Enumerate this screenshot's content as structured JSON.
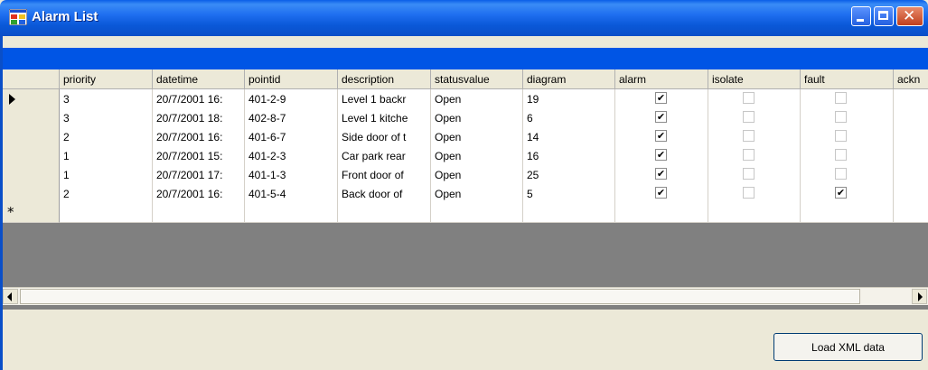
{
  "window": {
    "title": "Alarm List"
  },
  "grid": {
    "columns": [
      "priority",
      "datetime",
      "pointid",
      "description",
      "statusvalue",
      "diagram",
      "alarm",
      "isolate",
      "fault",
      "ackn"
    ],
    "rows": [
      {
        "priority": "3",
        "datetime": "20/7/2001 16:",
        "pointid": "401-2-9",
        "description": "Level 1 backr",
        "statusvalue": "Open",
        "diagram": "19",
        "alarm": true,
        "isolate": false,
        "fault": false,
        "current": true
      },
      {
        "priority": "3",
        "datetime": "20/7/2001 18:",
        "pointid": "402-8-7",
        "description": "Level 1 kitche",
        "statusvalue": "Open",
        "diagram": "6",
        "alarm": true,
        "isolate": false,
        "fault": false,
        "current": false
      },
      {
        "priority": "2",
        "datetime": "20/7/2001 16:",
        "pointid": "401-6-7",
        "description": "Side door of t",
        "statusvalue": "Open",
        "diagram": "14",
        "alarm": true,
        "isolate": false,
        "fault": false,
        "current": false
      },
      {
        "priority": "1",
        "datetime": "20/7/2001 15:",
        "pointid": "401-2-3",
        "description": "Car park rear",
        "statusvalue": "Open",
        "diagram": "16",
        "alarm": true,
        "isolate": false,
        "fault": false,
        "current": false
      },
      {
        "priority": "1",
        "datetime": "20/7/2001 17:",
        "pointid": "401-1-3",
        "description": "Front door of",
        "statusvalue": "Open",
        "diagram": "25",
        "alarm": true,
        "isolate": false,
        "fault": false,
        "current": false
      },
      {
        "priority": "2",
        "datetime": "20/7/2001 16:",
        "pointid": "401-5-4",
        "description": "Back door of",
        "statusvalue": "Open",
        "diagram": "5",
        "alarm": true,
        "isolate": false,
        "fault": true,
        "current": false
      }
    ],
    "new_row_marker": "*",
    "check_glyph": "✔"
  },
  "buttons": {
    "load_xml": "Load XML data"
  },
  "icons": {
    "app": "window-app-icon",
    "minimize": "minimize-icon",
    "maximize": "maximize-icon",
    "close": "close-icon",
    "current_row": "row-arrow-icon",
    "new_row": "new-row-star-icon"
  }
}
